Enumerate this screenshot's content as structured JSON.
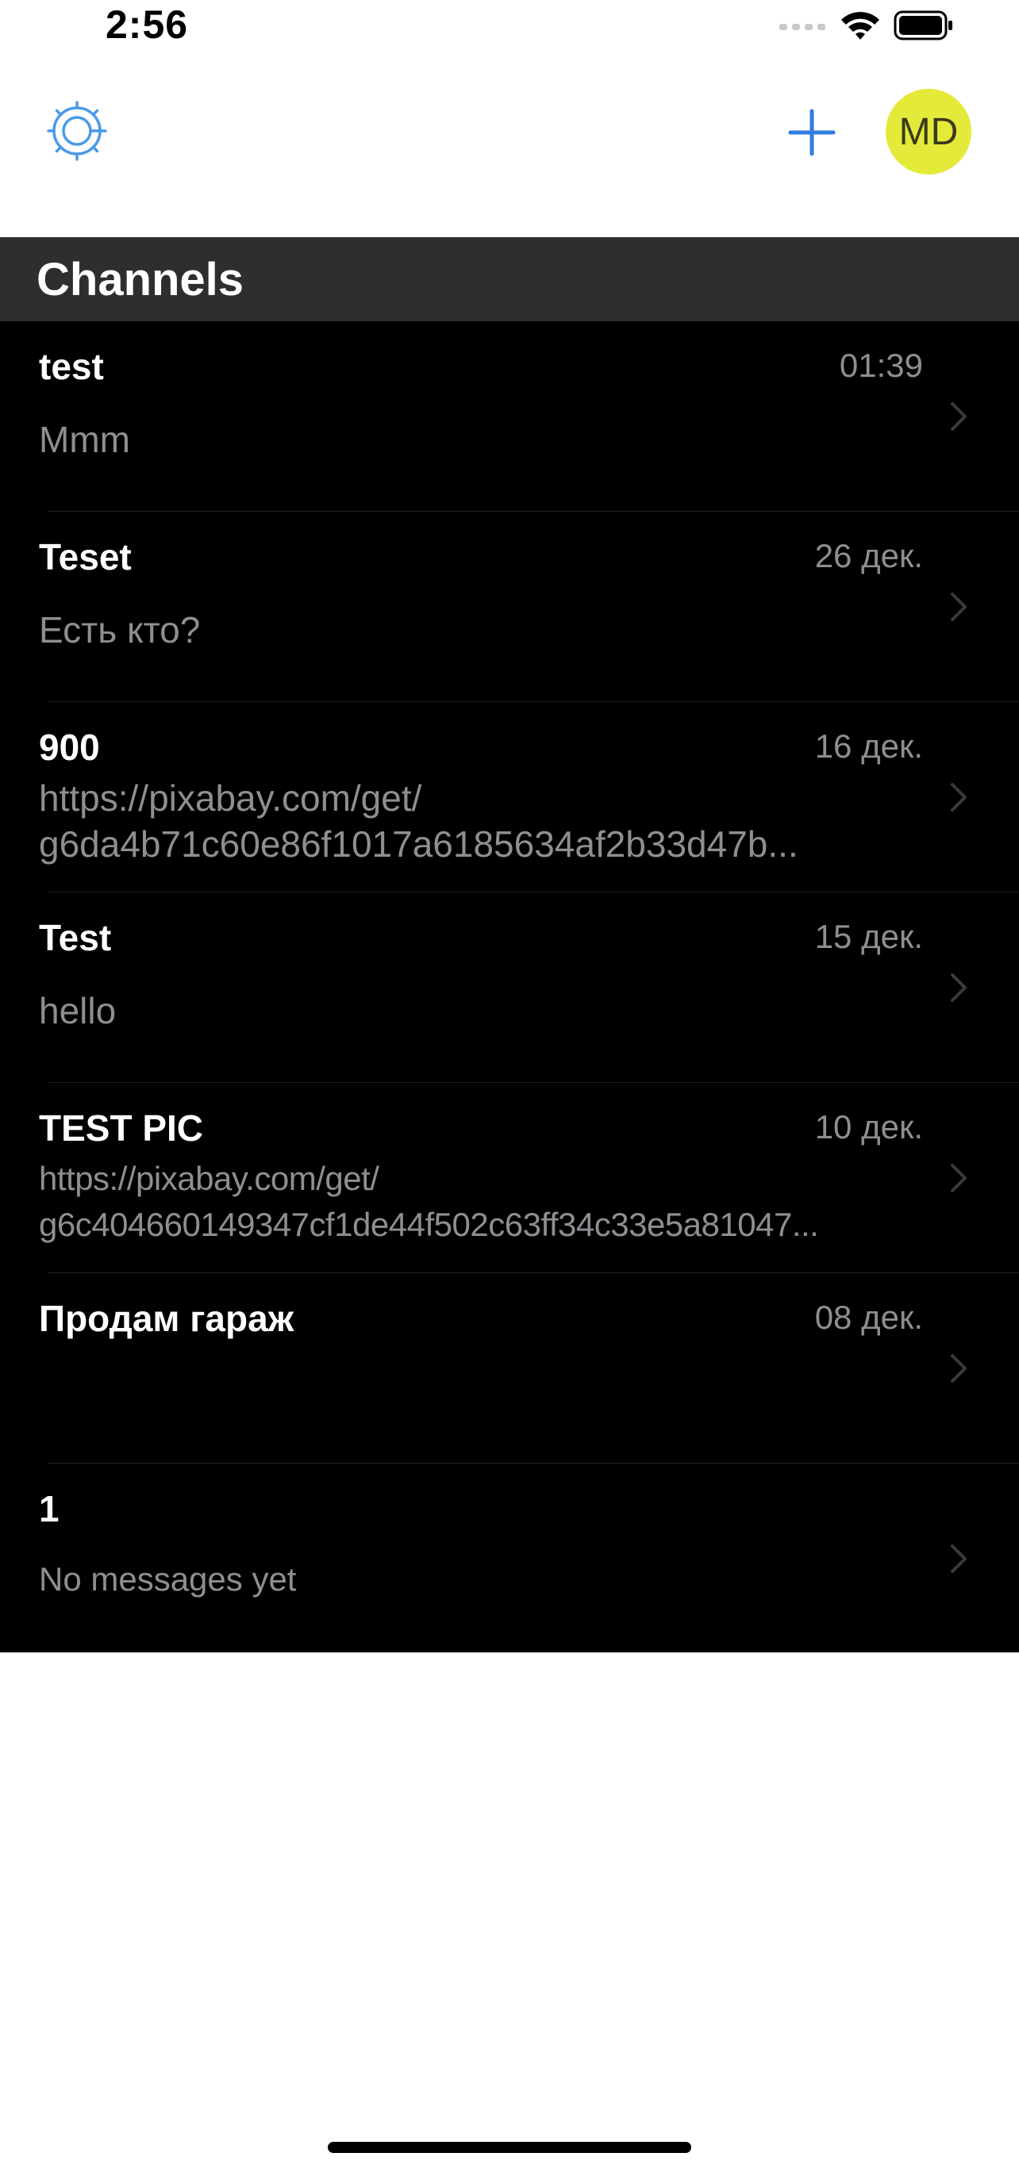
{
  "status_bar": {
    "time": "2:56",
    "icons": [
      "cellular-signal-icon",
      "wifi-icon",
      "battery-icon"
    ]
  },
  "nav": {
    "settings_icon": "gear-icon",
    "add_icon": "plus-icon",
    "avatar_initials": "MD",
    "avatar_color": "#e4ea3a",
    "accent_color": "#2f7de1"
  },
  "section": {
    "title": "Channels"
  },
  "channels": [
    {
      "name": "test",
      "date": "01:39",
      "preview": [
        "Mmm"
      ]
    },
    {
      "name": "Teset",
      "date": "26 дек.",
      "preview": [
        "Есть кто?"
      ]
    },
    {
      "name": "900",
      "date": "16 дек.",
      "preview": [
        "https://pixabay.com/get/",
        "g6da4b71c60e86f1017a6185634af2b33d47b..."
      ]
    },
    {
      "name": "Test",
      "date": "15 дек.",
      "preview": [
        "hello"
      ]
    },
    {
      "name": "TEST PIC",
      "date": "10 дек.",
      "preview": [
        "https://pixabay.com/get/",
        "g6c404660149347cf1de44f502c63ff34c33e5a81047..."
      ]
    },
    {
      "name": "Продам гараж",
      "date": "08 дек.",
      "preview": []
    },
    {
      "name": "1",
      "date": "",
      "preview": [
        "No messages yet"
      ]
    }
  ],
  "colors": {
    "list_background": "#000000",
    "section_header_background": "#2e2e2e",
    "secondary_text": "#8e8e93"
  }
}
